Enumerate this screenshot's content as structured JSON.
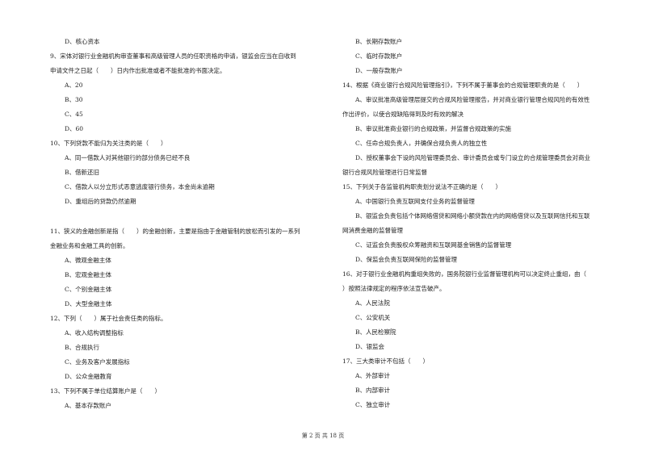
{
  "left_column": [
    {
      "kind": "opt",
      "text": "D、核心资本"
    },
    {
      "kind": "q",
      "text": "9、宋体对银行业金融机构审查董事和高级管理人员的任职资格的申请，银监会应当在自收到"
    },
    {
      "kind": "q",
      "text": "申请文件之日起（　　）日内作出批准或者不能批准的书面决定。"
    },
    {
      "kind": "opt",
      "text": "A、20"
    },
    {
      "kind": "opt",
      "text": "B、30"
    },
    {
      "kind": "opt",
      "text": "C、45"
    },
    {
      "kind": "opt",
      "text": "D、60"
    },
    {
      "kind": "q",
      "text": "10、下列贷款不能归为关注类的是（　　）"
    },
    {
      "kind": "opt",
      "text": "A、同一借款人对其他银行的部分债务已经不良"
    },
    {
      "kind": "opt",
      "text": "B、借新还旧"
    },
    {
      "kind": "opt",
      "text": "C、借款人以分立形式恶意逃废银行债务，本金尚未逾期"
    },
    {
      "kind": "opt",
      "text": "D、重组后的贷款仍然逾期"
    },
    {
      "kind": "q gap",
      "text": "11、狭义的金融创新是指（　　）的金融创新，主要是指由于金融管制的放松而引发的一系列"
    },
    {
      "kind": "q",
      "text": "金融业务和金融工具的创新。"
    },
    {
      "kind": "opt",
      "text": "A、微观金融主体"
    },
    {
      "kind": "opt",
      "text": "B、宏观金融主体"
    },
    {
      "kind": "opt",
      "text": "C、个别金融主体"
    },
    {
      "kind": "opt",
      "text": "D、大型金融主体"
    },
    {
      "kind": "q",
      "text": "12、下列（　　）属于社会责任类的指标。"
    },
    {
      "kind": "opt",
      "text": "A、收入结构调整指标"
    },
    {
      "kind": "opt",
      "text": "B、合规执行"
    },
    {
      "kind": "opt",
      "text": "C、业务及客户发展指标"
    },
    {
      "kind": "opt",
      "text": "D、公众金融教育"
    },
    {
      "kind": "q",
      "text": "13、下列不属于单位结算账户是（　　）"
    },
    {
      "kind": "opt",
      "text": "A、基本存款账户"
    }
  ],
  "right_column": [
    {
      "kind": "opt-r",
      "text": "B、长期存款账户"
    },
    {
      "kind": "opt-r",
      "text": "C、临时存款账户"
    },
    {
      "kind": "opt-r",
      "text": "D、一般存款账户"
    },
    {
      "kind": "q",
      "text": "14、根据《商业银行合规风险管理指引》，下列不属于董事会的合规管理职责的是（　　）"
    },
    {
      "kind": "opt-r",
      "text": "A、审议批准高级管理层提交的合规风险管理报告，并对商业银行管理合规风险的有效性"
    },
    {
      "kind": "q",
      "text": "作出评价，以使合规缺陷得到及时有效的解决"
    },
    {
      "kind": "opt-r",
      "text": "B、审议批准商业银行的合规政策，并监督合规政策的实施"
    },
    {
      "kind": "opt-r",
      "text": "C、任命合规负责人，并确保合规负责人的独立性"
    },
    {
      "kind": "opt-r",
      "text": "D、授权董事会下设的风险管理委员会、审计委员会或专门设立的合规管理委员会对商业"
    },
    {
      "kind": "q",
      "text": "银行合规风险管理进行日常监督"
    },
    {
      "kind": "q",
      "text": "15、下列关于各监管机构职责划分说法不正确的是（　　）"
    },
    {
      "kind": "opt-r",
      "text": "A、中国银行负责互联网支付业务的监督管理"
    },
    {
      "kind": "opt-r",
      "text": "B、银监会负责包括个体网络借贷和网络小额贷款在内的网络借贷以及互联网信托和互联"
    },
    {
      "kind": "q",
      "text": "网消费金融的监督管理"
    },
    {
      "kind": "opt-r",
      "text": "C、证监会负责股权众筹融资和互联网基金销售的监督管理"
    },
    {
      "kind": "opt-r",
      "text": "D、保监会负责互联网保险的监督管理"
    },
    {
      "kind": "q",
      "text": "16、对于银行业金融机构重组失败的，国务院银行业监督管理机构可以决定终止重组，由（"
    },
    {
      "kind": "q",
      "text": "）按照法律规定的程序依法宣告破产。"
    },
    {
      "kind": "opt-r",
      "text": "A、人民法院"
    },
    {
      "kind": "opt-r",
      "text": "C、公安机关"
    },
    {
      "kind": "opt-r",
      "text": "B、人民检察院"
    },
    {
      "kind": "opt-r",
      "text": "D、银监会"
    },
    {
      "kind": "q",
      "text": "17、三大类审计不包括（　　）"
    },
    {
      "kind": "opt-r",
      "text": "A、外部审计"
    },
    {
      "kind": "opt-r",
      "text": "B、内部审计"
    },
    {
      "kind": "opt-r",
      "text": "C、独立审计"
    }
  ],
  "footer": {
    "text": "第 2 页 共 18 页"
  }
}
